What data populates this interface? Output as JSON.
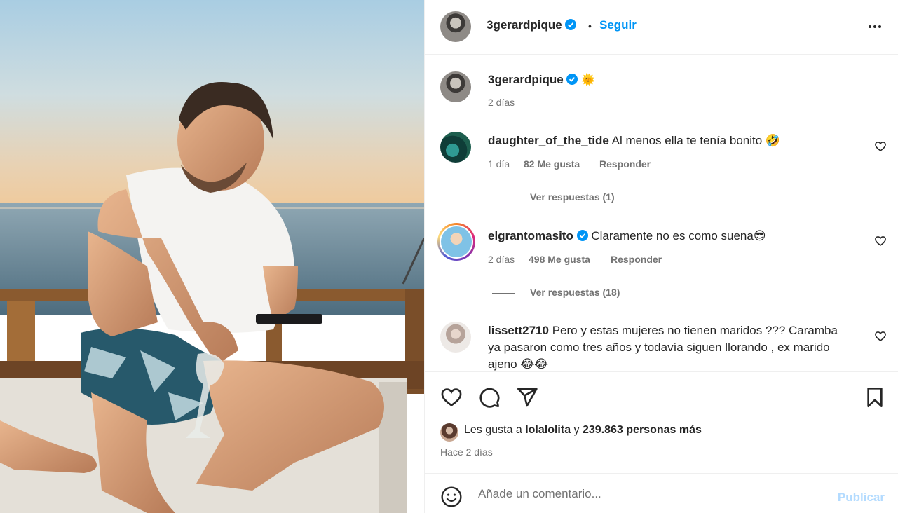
{
  "post": {
    "author": "3gerardpique",
    "follow_label": "Seguir",
    "separator": "•",
    "caption_emoji": "🌞",
    "caption_age": "2 días"
  },
  "comments": [
    {
      "user": "daughter_of_the_tide",
      "text": "Al menos ella te tenía bonito 🤣",
      "age": "1 día",
      "likes": "82 Me gusta",
      "reply": "Responder",
      "view_replies": "Ver respuestas (1)"
    },
    {
      "user": "elgrantomasito",
      "text": "Claramente no es como suena😎",
      "age": "2 días",
      "likes": "498 Me gusta",
      "reply": "Responder",
      "view_replies": "Ver respuestas (18)"
    },
    {
      "user": "lissett2710",
      "text": "Pero y estas mujeres no tienen maridos ??? Caramba ya pasaron como tres años y todavía siguen llorando , ex marido ajeno 😂😂"
    }
  ],
  "likes_line": {
    "prefix": "Les gusta a",
    "user": "lolalolita",
    "joiner": "y",
    "count": "239.863 personas más"
  },
  "post_age": "Hace 2 días",
  "composer": {
    "placeholder": "Añade un comentario...",
    "publish_label": "Publicar"
  },
  "colors": {
    "accent": "#0095f6",
    "publish_disabled": "#b3dbff",
    "verified": "#0095f6"
  },
  "icons": [
    "more-options-icon",
    "verified-icon",
    "heart-icon",
    "comment-icon",
    "share-icon",
    "save-icon",
    "emoji-icon"
  ]
}
